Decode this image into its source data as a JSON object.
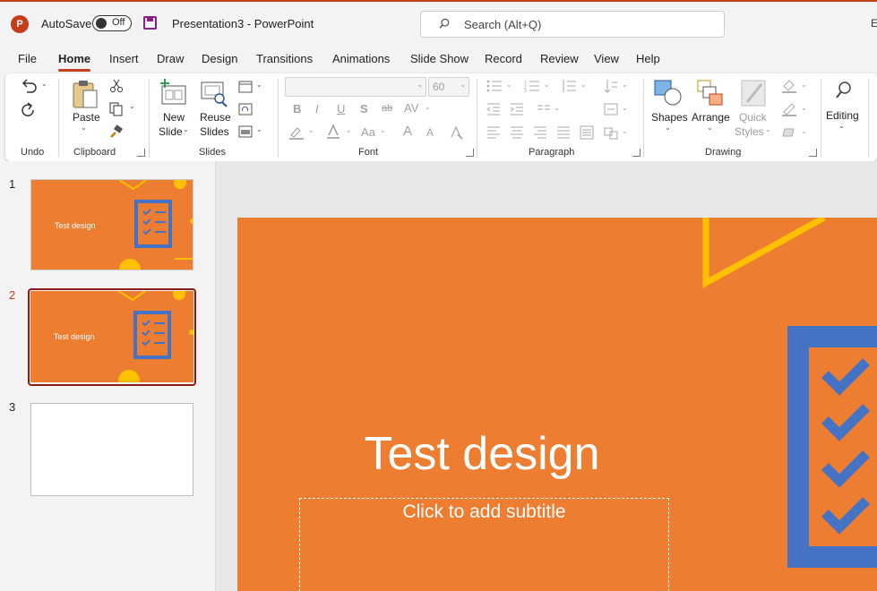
{
  "titlebar": {
    "app_icon": "P",
    "autosave_label": "AutoSave",
    "autosave_state": "Off",
    "document_title": "Presentation3  -  PowerPoint",
    "search_placeholder": "Search (Alt+Q)",
    "right_edge_char": "E",
    "accent_color": "#c43e1c"
  },
  "tabs": [
    "File",
    "Home",
    "Insert",
    "Draw",
    "Design",
    "Transitions",
    "Animations",
    "Slide Show",
    "Record",
    "Review",
    "View",
    "Help"
  ],
  "active_tab": "Home",
  "ribbon": {
    "groups": {
      "undo": "Undo",
      "clipboard": "Clipboard",
      "slides": "Slides",
      "font": "Font",
      "paragraph": "Paragraph",
      "drawing": "Drawing"
    },
    "paste": "Paste",
    "new_slide_line1": "New",
    "new_slide_line2": "Slide",
    "reuse_line1": "Reuse",
    "reuse_line2": "Slides",
    "font_size": "60",
    "shapes": "Shapes",
    "arrange": "Arrange",
    "quick_line1": "Quick",
    "quick_line2": "Styles",
    "editing": "Editing",
    "font_glyphs": {
      "bold": "B",
      "italic": "I",
      "underline": "U",
      "shadow": "S",
      "strike": "ab",
      "spacing": "AV",
      "case": "Aa",
      "grow": "A",
      "shrink": "A"
    }
  },
  "slides": [
    {
      "number": "1",
      "title": "Test design",
      "selected": false
    },
    {
      "number": "2",
      "title": "Test design",
      "selected": true
    },
    {
      "number": "3",
      "title": "",
      "selected": false
    }
  ],
  "slide": {
    "title": "Test design",
    "subtitle_placeholder": "Click to add subtitle",
    "background_color": "#ed7d31",
    "accent_yellow": "#ffc000",
    "checklist_blue": "#4472c4"
  }
}
